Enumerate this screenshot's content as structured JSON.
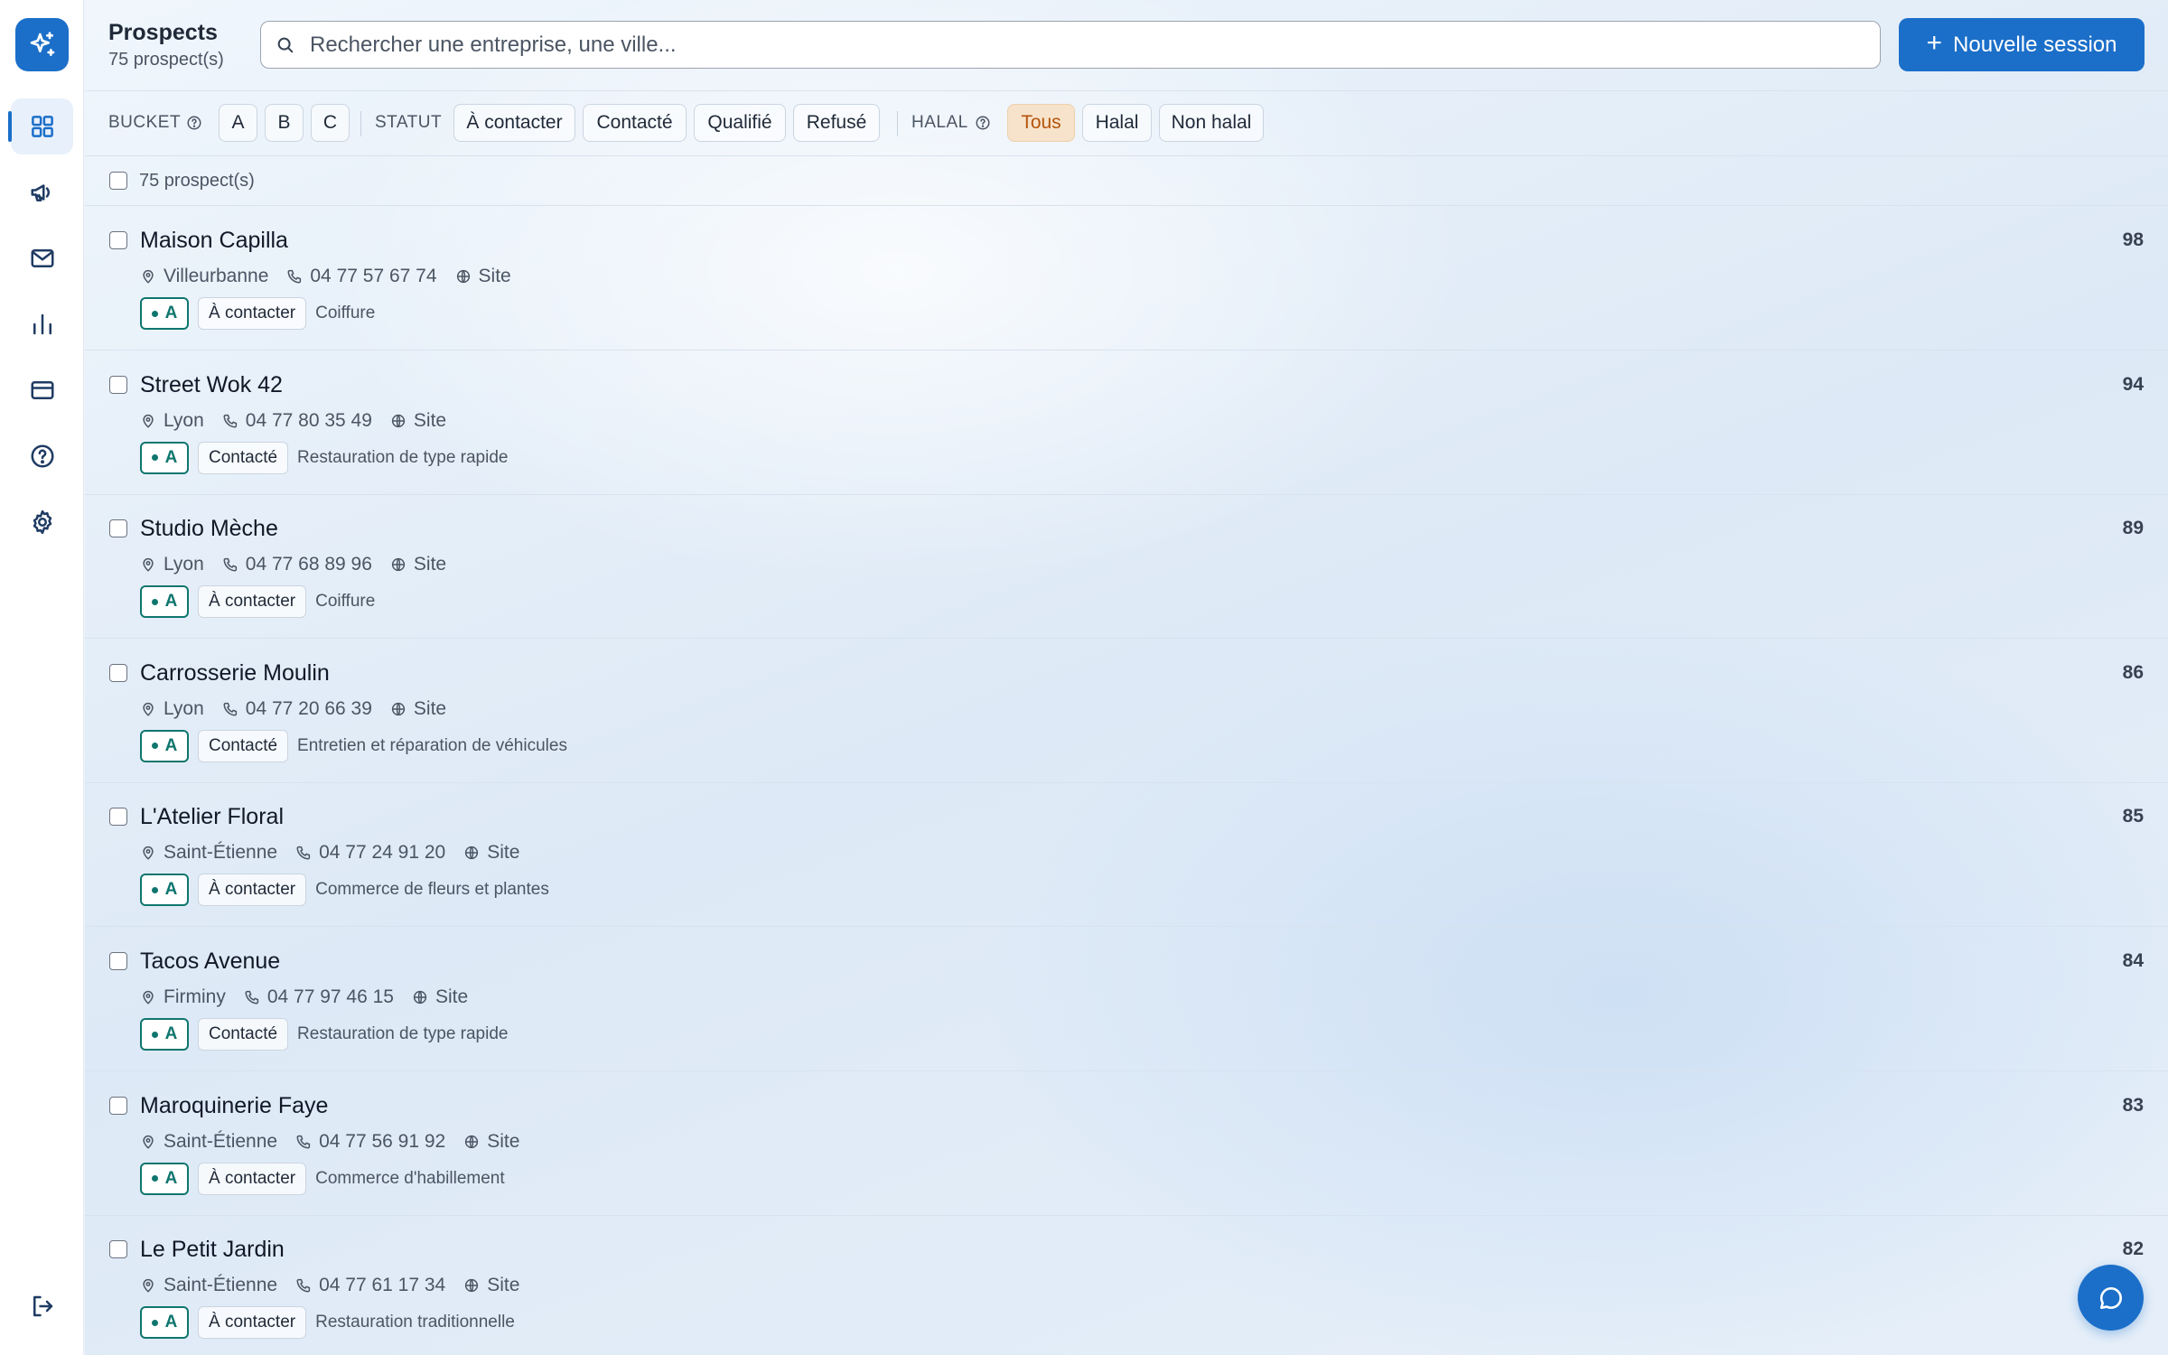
{
  "nav": {
    "logo_icon": "sparkles-icon",
    "items": [
      {
        "icon": "dashboard-icon",
        "active": true
      },
      {
        "icon": "megaphone-icon"
      },
      {
        "icon": "mail-icon"
      },
      {
        "icon": "bar-chart-icon"
      },
      {
        "icon": "credit-card-icon"
      },
      {
        "icon": "help-circle-icon"
      },
      {
        "icon": "settings-icon"
      }
    ],
    "logout_icon": "logout-icon"
  },
  "header": {
    "title": "Prospects",
    "subtitle": "75 prospect(s)",
    "search_placeholder": "Rechercher une entreprise, une ville...",
    "search_value": "",
    "new_session_label": "Nouvelle session"
  },
  "filters": {
    "bucket_label": "BUCKET",
    "bucket_options": [
      "A",
      "B",
      "C"
    ],
    "status_label": "STATUT",
    "status_options": [
      "À contacter",
      "Contacté",
      "Qualifié",
      "Refusé"
    ],
    "halal_label": "HALAL",
    "halal_options": [
      "Tous",
      "Halal",
      "Non halal"
    ],
    "halal_selected": "Tous"
  },
  "list": {
    "count_label": "75 prospect(s)",
    "site_label": "Site",
    "rows": [
      {
        "name": "Maison Capilla",
        "city": "Villeurbanne",
        "phone": "04 77 57 67 74",
        "bucket": "A",
        "status": "À contacter",
        "category": "Coiffure",
        "score": "98"
      },
      {
        "name": "Street Wok 42",
        "city": "Lyon",
        "phone": "04 77 80 35 49",
        "bucket": "A",
        "status": "Contacté",
        "category": "Restauration de type rapide",
        "score": "94"
      },
      {
        "name": "Studio Mèche",
        "city": "Lyon",
        "phone": "04 77 68 89 96",
        "bucket": "A",
        "status": "À contacter",
        "category": "Coiffure",
        "score": "89"
      },
      {
        "name": "Carrosserie Moulin",
        "city": "Lyon",
        "phone": "04 77 20 66 39",
        "bucket": "A",
        "status": "Contacté",
        "category": "Entretien et réparation de véhicules",
        "score": "86"
      },
      {
        "name": "L'Atelier Floral",
        "city": "Saint-Étienne",
        "phone": "04 77 24 91 20",
        "bucket": "A",
        "status": "À contacter",
        "category": "Commerce de fleurs et plantes",
        "score": "85"
      },
      {
        "name": "Tacos Avenue",
        "city": "Firminy",
        "phone": "04 77 97 46 15",
        "bucket": "A",
        "status": "Contacté",
        "category": "Restauration de type rapide",
        "score": "84"
      },
      {
        "name": "Maroquinerie Faye",
        "city": "Saint-Étienne",
        "phone": "04 77 56 91 92",
        "bucket": "A",
        "status": "À contacter",
        "category": "Commerce d'habillement",
        "score": "83"
      },
      {
        "name": "Le Petit Jardin",
        "city": "Saint-Étienne",
        "phone": "04 77 61 17 34",
        "bucket": "A",
        "status": "À contacter",
        "category": "Restauration traditionnelle",
        "score": "82"
      }
    ]
  },
  "chat": {
    "icon": "chat-bubble-icon"
  },
  "colors": {
    "accent": "#1b6fc9",
    "bucket_a": "#0f766e",
    "active_chip_bg": "#f7e3cc",
    "active_chip_text": "#b45309"
  }
}
